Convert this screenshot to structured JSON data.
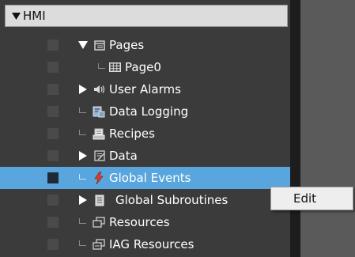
{
  "tree": {
    "root": {
      "label": "HMI",
      "expanded": true
    },
    "items": [
      {
        "label": "Pages",
        "expander": "expanded",
        "icon": "pages-folder-icon",
        "level": 1
      },
      {
        "label": "Page0",
        "expander": "none",
        "icon": "page-grid-icon",
        "level": 2
      },
      {
        "label": "User Alarms",
        "expander": "collapsed",
        "icon": "speaker-alarm-icon",
        "level": 1
      },
      {
        "label": "Data Logging",
        "expander": "none",
        "icon": "data-logging-icon",
        "level": 1
      },
      {
        "label": "Recipes",
        "expander": "none",
        "icon": "recipes-icon",
        "level": 1
      },
      {
        "label": "Data",
        "expander": "collapsed",
        "icon": "data-icon",
        "level": 1
      },
      {
        "label": "Global Events",
        "expander": "none",
        "icon": "lightning-icon",
        "level": 1,
        "selected": true
      },
      {
        "label": "Global Subroutines",
        "expander": "collapsed",
        "icon": "subroutine-icon",
        "level": 1
      },
      {
        "label": "Resources",
        "expander": "none",
        "icon": "resources-icon",
        "level": 1
      },
      {
        "label": "IAG Resources",
        "expander": "none",
        "icon": "iag-resources-icon",
        "level": 1
      }
    ]
  },
  "context_menu": {
    "items": [
      {
        "label": "Edit"
      }
    ]
  },
  "colors": {
    "panel_bg": "#3b3b3b",
    "selection": "#58a6dd",
    "header_bg": "#dcdcdc",
    "menu_bg": "#eeeeee",
    "lightning": "#e03a2a"
  }
}
